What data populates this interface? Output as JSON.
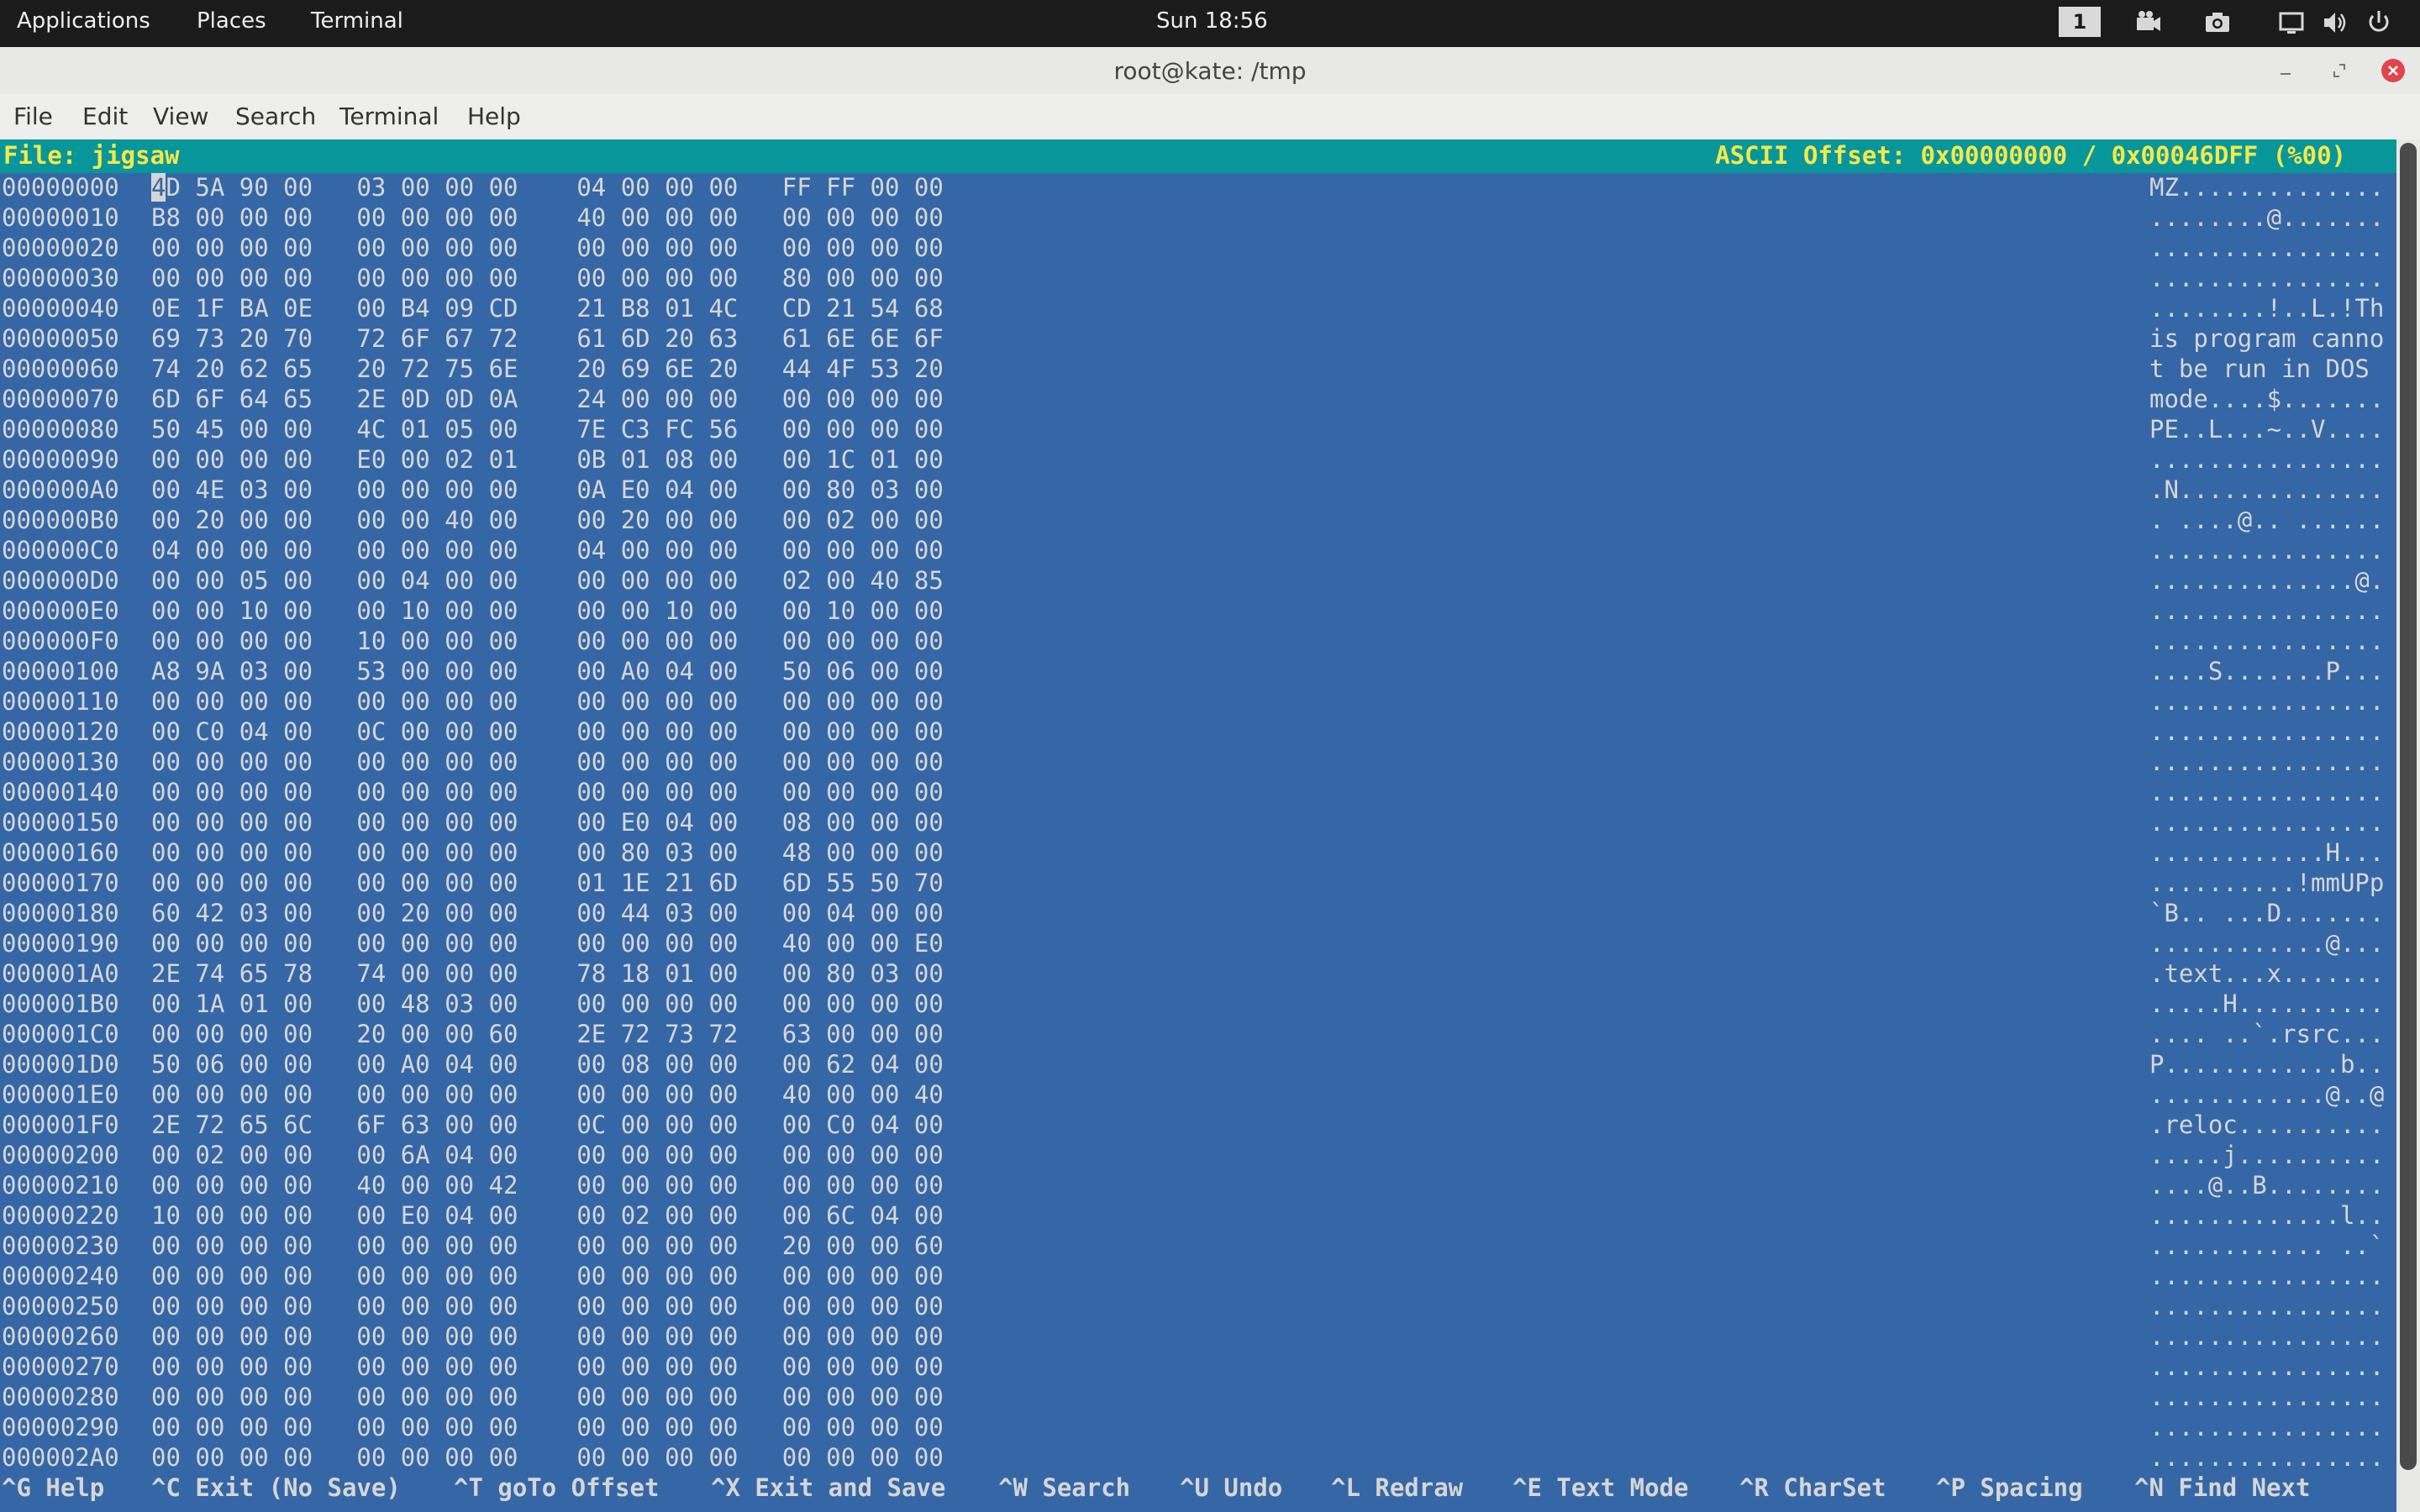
{
  "panel": {
    "applications": "Applications",
    "places": "Places",
    "terminal": "Terminal",
    "clock": "Sun 18:56",
    "workspace": "1"
  },
  "window": {
    "title": "root@kate: /tmp"
  },
  "menu": [
    "File",
    "Edit",
    "View",
    "Search",
    "Terminal",
    "Help"
  ],
  "editor": {
    "file_label": "File: jigsaw",
    "offset_label": "ASCII Offset: 0x00000000 / 0x00046DFF (%00)",
    "lines": [
      {
        "off": "00000000",
        "hex": "4D 5A 90 00   03 00 00 00    04 00 00 00   FF FF 00 00",
        "asc": "MZ.............."
      },
      {
        "off": "00000010",
        "hex": "B8 00 00 00   00 00 00 00    40 00 00 00   00 00 00 00",
        "asc": "........@......."
      },
      {
        "off": "00000020",
        "hex": "00 00 00 00   00 00 00 00    00 00 00 00   00 00 00 00",
        "asc": "................"
      },
      {
        "off": "00000030",
        "hex": "00 00 00 00   00 00 00 00    00 00 00 00   80 00 00 00",
        "asc": "................"
      },
      {
        "off": "00000040",
        "hex": "0E 1F BA 0E   00 B4 09 CD    21 B8 01 4C   CD 21 54 68",
        "asc": "........!..L.!Th"
      },
      {
        "off": "00000050",
        "hex": "69 73 20 70   72 6F 67 72    61 6D 20 63   61 6E 6E 6F",
        "asc": "is program canno"
      },
      {
        "off": "00000060",
        "hex": "74 20 62 65   20 72 75 6E    20 69 6E 20   44 4F 53 20",
        "asc": "t be run in DOS "
      },
      {
        "off": "00000070",
        "hex": "6D 6F 64 65   2E 0D 0D 0A    24 00 00 00   00 00 00 00",
        "asc": "mode....$......."
      },
      {
        "off": "00000080",
        "hex": "50 45 00 00   4C 01 05 00    7E C3 FC 56   00 00 00 00",
        "asc": "PE..L...~..V...."
      },
      {
        "off": "00000090",
        "hex": "00 00 00 00   E0 00 02 01    0B 01 08 00   00 1C 01 00",
        "asc": "................"
      },
      {
        "off": "000000A0",
        "hex": "00 4E 03 00   00 00 00 00    0A E0 04 00   00 80 03 00",
        "asc": ".N.............."
      },
      {
        "off": "000000B0",
        "hex": "00 20 00 00   00 00 40 00    00 20 00 00   00 02 00 00",
        "asc": ". ....@.. ......"
      },
      {
        "off": "000000C0",
        "hex": "04 00 00 00   00 00 00 00    04 00 00 00   00 00 00 00",
        "asc": "................"
      },
      {
        "off": "000000D0",
        "hex": "00 00 05 00   00 04 00 00    00 00 00 00   02 00 40 85",
        "asc": "..............@."
      },
      {
        "off": "000000E0",
        "hex": "00 00 10 00   00 10 00 00    00 00 10 00   00 10 00 00",
        "asc": "................"
      },
      {
        "off": "000000F0",
        "hex": "00 00 00 00   10 00 00 00    00 00 00 00   00 00 00 00",
        "asc": "................"
      },
      {
        "off": "00000100",
        "hex": "A8 9A 03 00   53 00 00 00    00 A0 04 00   50 06 00 00",
        "asc": "....S.......P..."
      },
      {
        "off": "00000110",
        "hex": "00 00 00 00   00 00 00 00    00 00 00 00   00 00 00 00",
        "asc": "................"
      },
      {
        "off": "00000120",
        "hex": "00 C0 04 00   0C 00 00 00    00 00 00 00   00 00 00 00",
        "asc": "................"
      },
      {
        "off": "00000130",
        "hex": "00 00 00 00   00 00 00 00    00 00 00 00   00 00 00 00",
        "asc": "................"
      },
      {
        "off": "00000140",
        "hex": "00 00 00 00   00 00 00 00    00 00 00 00   00 00 00 00",
        "asc": "................"
      },
      {
        "off": "00000150",
        "hex": "00 00 00 00   00 00 00 00    00 E0 04 00   08 00 00 00",
        "asc": "................"
      },
      {
        "off": "00000160",
        "hex": "00 00 00 00   00 00 00 00    00 80 03 00   48 00 00 00",
        "asc": "............H..."
      },
      {
        "off": "00000170",
        "hex": "00 00 00 00   00 00 00 00    01 1E 21 6D   6D 55 50 70",
        "asc": "..........!mmUPp"
      },
      {
        "off": "00000180",
        "hex": "60 42 03 00   00 20 00 00    00 44 03 00   00 04 00 00",
        "asc": "`B.. ...D......."
      },
      {
        "off": "00000190",
        "hex": "00 00 00 00   00 00 00 00    00 00 00 00   40 00 00 E0",
        "asc": "............@..."
      },
      {
        "off": "000001A0",
        "hex": "2E 74 65 78   74 00 00 00    78 18 01 00   00 80 03 00",
        "asc": ".text...x......."
      },
      {
        "off": "000001B0",
        "hex": "00 1A 01 00   00 48 03 00    00 00 00 00   00 00 00 00",
        "asc": ".....H.........."
      },
      {
        "off": "000001C0",
        "hex": "00 00 00 00   20 00 00 60    2E 72 73 72   63 00 00 00",
        "asc": ".... ..`.rsrc..."
      },
      {
        "off": "000001D0",
        "hex": "50 06 00 00   00 A0 04 00    00 08 00 00   00 62 04 00",
        "asc": "P............b.."
      },
      {
        "off": "000001E0",
        "hex": "00 00 00 00   00 00 00 00    00 00 00 00   40 00 00 40",
        "asc": "............@..@"
      },
      {
        "off": "000001F0",
        "hex": "2E 72 65 6C   6F 63 00 00    0C 00 00 00   00 C0 04 00",
        "asc": ".reloc.........."
      },
      {
        "off": "00000200",
        "hex": "00 02 00 00   00 6A 04 00    00 00 00 00   00 00 00 00",
        "asc": ".....j.........."
      },
      {
        "off": "00000210",
        "hex": "00 00 00 00   40 00 00 42    00 00 00 00   00 00 00 00",
        "asc": "....@..B........"
      },
      {
        "off": "00000220",
        "hex": "10 00 00 00   00 E0 04 00    00 02 00 00   00 6C 04 00",
        "asc": ".............l.."
      },
      {
        "off": "00000230",
        "hex": "00 00 00 00   00 00 00 00    00 00 00 00   20 00 00 60",
        "asc": "............ ..`"
      },
      {
        "off": "00000240",
        "hex": "00 00 00 00   00 00 00 00    00 00 00 00   00 00 00 00",
        "asc": "................"
      },
      {
        "off": "00000250",
        "hex": "00 00 00 00   00 00 00 00    00 00 00 00   00 00 00 00",
        "asc": "................"
      },
      {
        "off": "00000260",
        "hex": "00 00 00 00   00 00 00 00    00 00 00 00   00 00 00 00",
        "asc": "................"
      },
      {
        "off": "00000270",
        "hex": "00 00 00 00   00 00 00 00    00 00 00 00   00 00 00 00",
        "asc": "................"
      },
      {
        "off": "00000280",
        "hex": "00 00 00 00   00 00 00 00    00 00 00 00   00 00 00 00",
        "asc": "................"
      },
      {
        "off": "00000290",
        "hex": "00 00 00 00   00 00 00 00    00 00 00 00   00 00 00 00",
        "asc": "................"
      },
      {
        "off": "000002A0",
        "hex": "00 00 00 00   00 00 00 00    00 00 00 00   00 00 00 00",
        "asc": "................"
      }
    ],
    "help": [
      "^G Help",
      "^C Exit (No Save)",
      "^T goTo Offset",
      "^X Exit and Save",
      "^W Search",
      "^U Undo",
      "^L Redraw",
      "^E Text Mode",
      "^R CharSet",
      "^P Spacing",
      "^N Find Next"
    ]
  }
}
